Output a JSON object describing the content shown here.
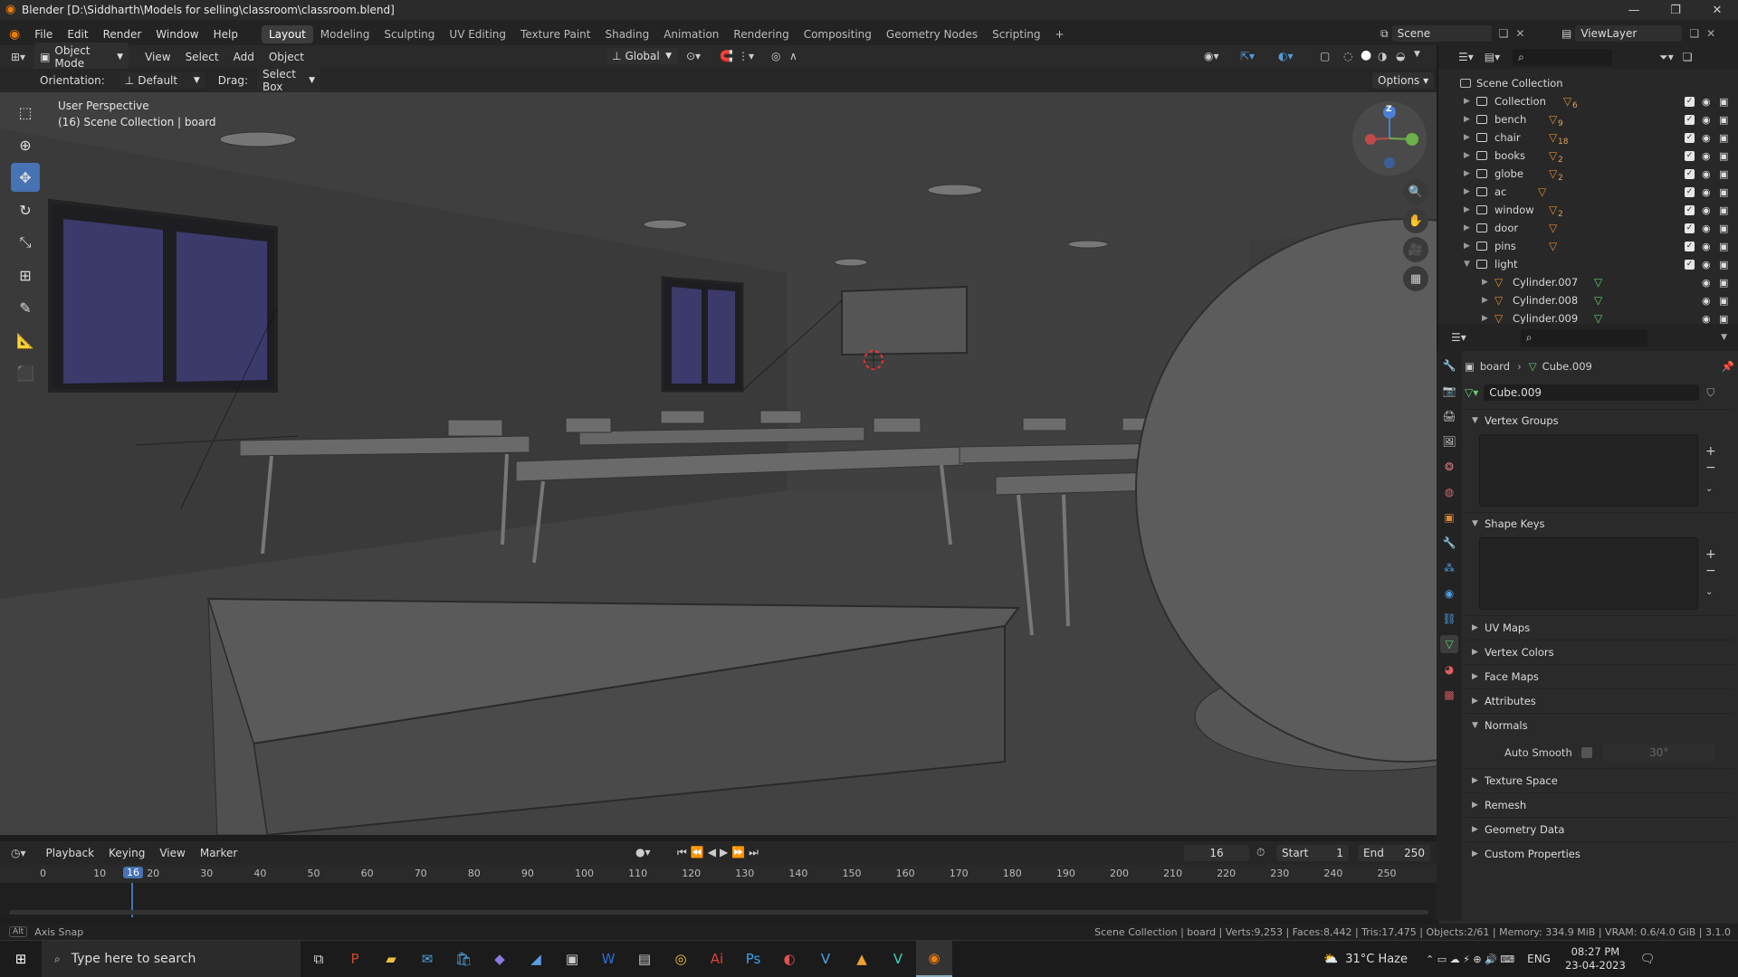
{
  "window": {
    "title": "Blender [D:\\Siddharth\\Models for selling\\classroom\\classroom.blend]",
    "min": "—",
    "max": "❐",
    "close": "✕"
  },
  "menus": [
    "File",
    "Edit",
    "Render",
    "Window",
    "Help"
  ],
  "workspaces": [
    "Layout",
    "Modeling",
    "Sculpting",
    "UV Editing",
    "Texture Paint",
    "Shading",
    "Animation",
    "Rendering",
    "Compositing",
    "Geometry Nodes",
    "Scripting"
  ],
  "workspace_add": "+",
  "scene": {
    "label": "Scene",
    "viewlayer": "ViewLayer"
  },
  "viewport_header": {
    "mode": "Object Mode",
    "menus": [
      "View",
      "Select",
      "Add",
      "Object"
    ],
    "transform": "Global"
  },
  "tool_header": {
    "orientation_label": "Orientation:",
    "orientation_value": "Default",
    "drag_label": "Drag:",
    "drag_value": "Select Box",
    "options": "Options"
  },
  "viewport": {
    "perspective": "User Perspective",
    "collection_info": "(16) Scene Collection | board",
    "gizmo_z": "Z"
  },
  "outliner": {
    "root": "Scene Collection",
    "rows": [
      {
        "name": "Collection",
        "count": "6"
      },
      {
        "name": "bench",
        "count": "9"
      },
      {
        "name": "chair",
        "count": "18"
      },
      {
        "name": "books",
        "count": "2"
      },
      {
        "name": "globe",
        "count": "2"
      },
      {
        "name": "ac",
        "count": ""
      },
      {
        "name": "window",
        "count": "2"
      },
      {
        "name": "door",
        "count": ""
      },
      {
        "name": "pins",
        "count": ""
      },
      {
        "name": "light",
        "count": ""
      }
    ],
    "children": [
      "Cylinder.007",
      "Cylinder.008",
      "Cylinder.009"
    ]
  },
  "properties": {
    "breadcrumb_object": "board",
    "breadcrumb_data": "Cube.009",
    "data_name": "Cube.009",
    "sections": {
      "vertex_groups": "Vertex Groups",
      "shape_keys": "Shape Keys",
      "uv_maps": "UV Maps",
      "vertex_colors": "Vertex Colors",
      "face_maps": "Face Maps",
      "attributes": "Attributes",
      "normals": "Normals",
      "auto_smooth": "Auto Smooth",
      "angle": "30°",
      "texture_space": "Texture Space",
      "remesh": "Remesh",
      "geometry_data": "Geometry Data",
      "custom_props": "Custom Properties"
    }
  },
  "timeline": {
    "menus": [
      "Playback",
      "Keying",
      "View",
      "Marker"
    ],
    "current_frame": "16",
    "start_label": "Start",
    "start": "1",
    "end_label": "End",
    "end": "250",
    "ticks": [
      "0",
      "10",
      "20",
      "30",
      "40",
      "50",
      "60",
      "70",
      "80",
      "90",
      "100",
      "110",
      "120",
      "130",
      "140",
      "150",
      "160",
      "170",
      "180",
      "190",
      "200",
      "210",
      "220",
      "230",
      "240",
      "250"
    ]
  },
  "status": {
    "left": "Axis Snap",
    "alt": "Alt",
    "right": "Scene Collection | board | Verts:9,253 | Faces:8,442 | Tris:17,475 | Objects:2/61 | Memory: 334.9 MiB | VRAM: 0.6/4.0 GiB | 3.1.0"
  },
  "taskbar": {
    "search": "Type here to search",
    "weather": "31°C  Haze",
    "lang": "ENG",
    "time": "08:27 PM",
    "date": "23-04-2023"
  },
  "colors": {
    "accent": "#4772b3",
    "orange": "#e08a2e",
    "green": "#5fcf6a"
  }
}
